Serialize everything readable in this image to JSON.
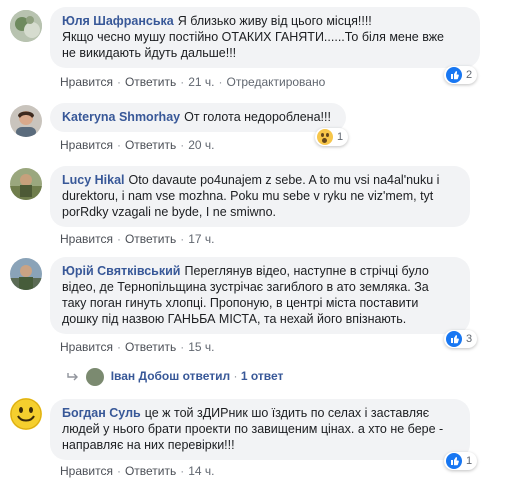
{
  "comments": [
    {
      "author": "Юля Шафранська",
      "text_lines": [
        "Я близько живу від цього місця!!!!",
        "Якщо чесно мушу постійно ОТАКИХ ГАНЯТИ......То біля мене вже",
        "не викидають йдуть дальше!!!"
      ],
      "like": "Нравится",
      "reply": "Ответить",
      "time": "21 ч.",
      "extra": "Отредактировано",
      "reaction_count": "2",
      "reaction_icon": "like-icon"
    },
    {
      "author": "Kateryna Shmorhay",
      "text_lines": [
        "От голота недороблена!!!"
      ],
      "like": "Нравится",
      "reply": "Ответить",
      "time": "20 ч.",
      "reaction_count": "1",
      "reaction_icon": "wow-icon"
    },
    {
      "author": "Lucy Hikal",
      "text_lines": [
        "Oto davaute po4unajem z sebe. A to mu vsi na4al'nuku i",
        "durektoru, i nam vse mozhna. Poku mu sebe v ryku ne viz'mem, tyt",
        "porRdky vzagali ne byde, I ne smiwno."
      ],
      "like": "Нравится",
      "reply": "Ответить",
      "time": "17 ч."
    },
    {
      "author": "Юрій Святківський",
      "text_lines": [
        "Переглянув відео, наступне в стрічці було",
        "відео, де Тернопільщина зустрічає загиблого в ато земляка. За",
        "таку поган гинуть хлопці. Пропоную, в центрі міста поставити",
        "дошку під назвою ГАНЬБА МІСТА, та нехай його впізнають."
      ],
      "like": "Нравится",
      "reply": "Ответить",
      "time": "15 ч.",
      "reaction_count": "3",
      "reaction_icon": "like-icon",
      "replies": {
        "author": "Іван Добош",
        "action": "ответил",
        "count": "1 ответ"
      }
    },
    {
      "author": "Богдан Суль",
      "text_lines": [
        "це ж той зДИРник шо їздить по селах і заставляє",
        "людей у нього брати проекти по завищеним цінах. а хто не бере -",
        "направляє на них перевірки!!!"
      ],
      "like": "Нравится",
      "reply": "Ответить",
      "time": "14 ч.",
      "reaction_count": "1",
      "reaction_icon": "like-icon"
    }
  ],
  "colors": {
    "link": "#385898",
    "bubble": "#f2f3f5",
    "like_blue": "#1877f2"
  }
}
